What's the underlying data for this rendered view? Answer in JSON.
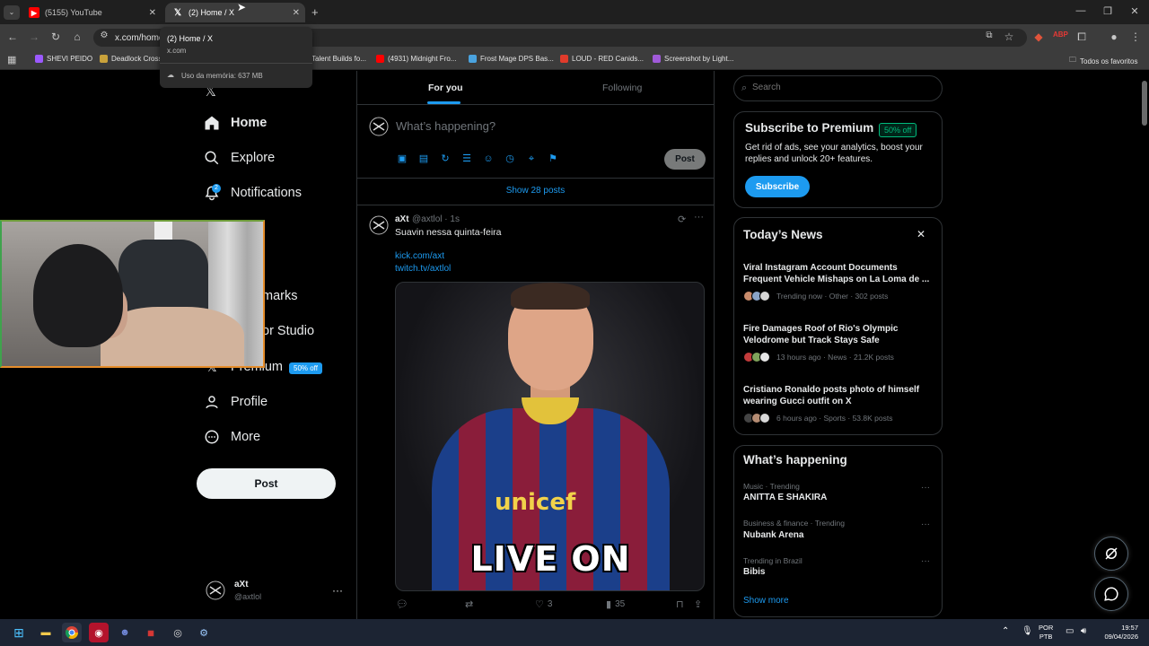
{
  "browser": {
    "tabs": [
      {
        "title": "(5155) YouTube",
        "favicon": "youtube-icon"
      },
      {
        "title": "(2) Home / X",
        "favicon": "x-icon",
        "active": true
      }
    ],
    "url": "x.com/home",
    "bookmarks": [
      {
        "label": "SHEVI PEIDO",
        "color": "#9b59ff"
      },
      {
        "label": "Deadlock Cross",
        "color": "#c9a23b"
      },
      {
        "label": "Talent Builds fo...",
        "color": "#888888"
      },
      {
        "label": "(4931) Midnight Fro...",
        "color": "#ff0000"
      },
      {
        "label": "Frost Mage DPS Bas...",
        "color": "#4aa3df"
      },
      {
        "label": "LOUD - RED Canids...",
        "color": "#e03b2b"
      },
      {
        "label": "Screenshot by Light...",
        "color": "#a05ad9"
      }
    ],
    "all_bookmarks": "Todos os favoritos",
    "tooltip": {
      "title": "(2) Home / X",
      "domain": "x.com",
      "memory": "Uso da memória: 637 MB"
    }
  },
  "nav": {
    "home": "Home",
    "explore": "Explore",
    "notifications": "Notifications",
    "notifications_badge": "2",
    "bookmarks_partial": "marks",
    "creator_partial": "or Studio",
    "premium": "Premium",
    "premium_badge": "50% off",
    "profile": "Profile",
    "more": "More",
    "post_button": "Post"
  },
  "account": {
    "name": "aXt",
    "handle": "@axtlol"
  },
  "timeline": {
    "tab_foryou": "For you",
    "tab_following": "Following",
    "compose_placeholder": "What’s happening?",
    "compose_post": "Post",
    "show_posts": "Show 28 posts",
    "post": {
      "name": "aXt",
      "handle_time": "@axtlol · 1s",
      "text": "Suavin nessa quinta-feira",
      "link1": "kick.com/axt",
      "link2": "twitch.tv/axtlol",
      "media_text_shirt": "unicef",
      "media_text_overlay": "LIVE ON",
      "likes": "3",
      "views": "35"
    }
  },
  "sidebar": {
    "search_placeholder": "Search",
    "premium": {
      "title": "Subscribe to Premium",
      "badge": "50% off",
      "desc": "Get rid of ads, see your analytics, boost your replies and unlock 20+ features.",
      "button": "Subscribe"
    },
    "news": {
      "title": "Today’s News",
      "items": [
        {
          "headline": "Viral Instagram Account Documents Frequent Vehicle Mishaps on La Loma de ...",
          "meta": "Trending now · Other · 302 posts"
        },
        {
          "headline": "Fire Damages Roof of Rio's Olympic Velodrome but Track Stays Safe",
          "meta": "13 hours ago · News · 21.2K posts"
        },
        {
          "headline": "Cristiano Ronaldo posts photo of himself wearing Gucci outfit on X",
          "meta": "6 hours ago · Sports · 53.8K posts"
        }
      ]
    },
    "happening": {
      "title": "What’s happening",
      "items": [
        {
          "meta": "Music · Trending",
          "name": "ANITTA E SHAKIRA"
        },
        {
          "meta": "Business & finance · Trending",
          "name": "Nubank Arena"
        },
        {
          "meta": "Trending in Brazil",
          "name": "Bibis"
        }
      ],
      "show_more": "Show more"
    }
  },
  "taskbar": {
    "lang1": "POR",
    "lang2": "PTB",
    "time": "19:57",
    "date": "09/04/2026"
  },
  "colors": {
    "accent": "#1d9bf0",
    "premium_green": "#00ba7c"
  }
}
